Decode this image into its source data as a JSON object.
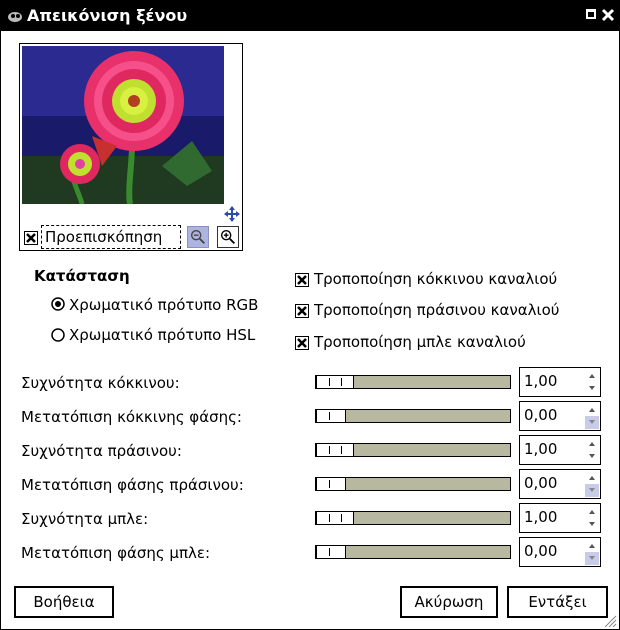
{
  "window": {
    "title": "Απεικόνιση ξένου"
  },
  "preview": {
    "label": "Προεπισκόπηση",
    "checked": true
  },
  "mode": {
    "section_label": "Κατάσταση",
    "options": [
      {
        "label": "Χρωματικό πρότυπο RGB",
        "selected": true
      },
      {
        "label": "Χρωματικό πρότυπο HSL",
        "selected": false
      }
    ]
  },
  "channels": [
    {
      "label": "Τροποποίηση κόκκινου καναλιού",
      "checked": true
    },
    {
      "label": "Τροποποίηση πράσινου καναλιού",
      "checked": true
    },
    {
      "label": "Τροποποίηση μπλε καναλιού",
      "checked": true
    }
  ],
  "params": [
    {
      "label": "Συχνότητα κόκκινου:",
      "value": "1,00"
    },
    {
      "label": "Μετατόπιση κόκκινης φάσης:",
      "value": "0,00"
    },
    {
      "label": "Συχνότητα πράσινου:",
      "value": "1,00"
    },
    {
      "label": "Μετατόπιση φάσης πράσινου:",
      "value": "0,00"
    },
    {
      "label": "Συχνότητα μπλε:",
      "value": "1,00"
    },
    {
      "label": "Μετατόπιση φάσης μπλε:",
      "value": "0,00"
    }
  ],
  "buttons": {
    "help": "Βοήθεια",
    "cancel": "Ακύρωση",
    "ok": "Εντάξει"
  }
}
